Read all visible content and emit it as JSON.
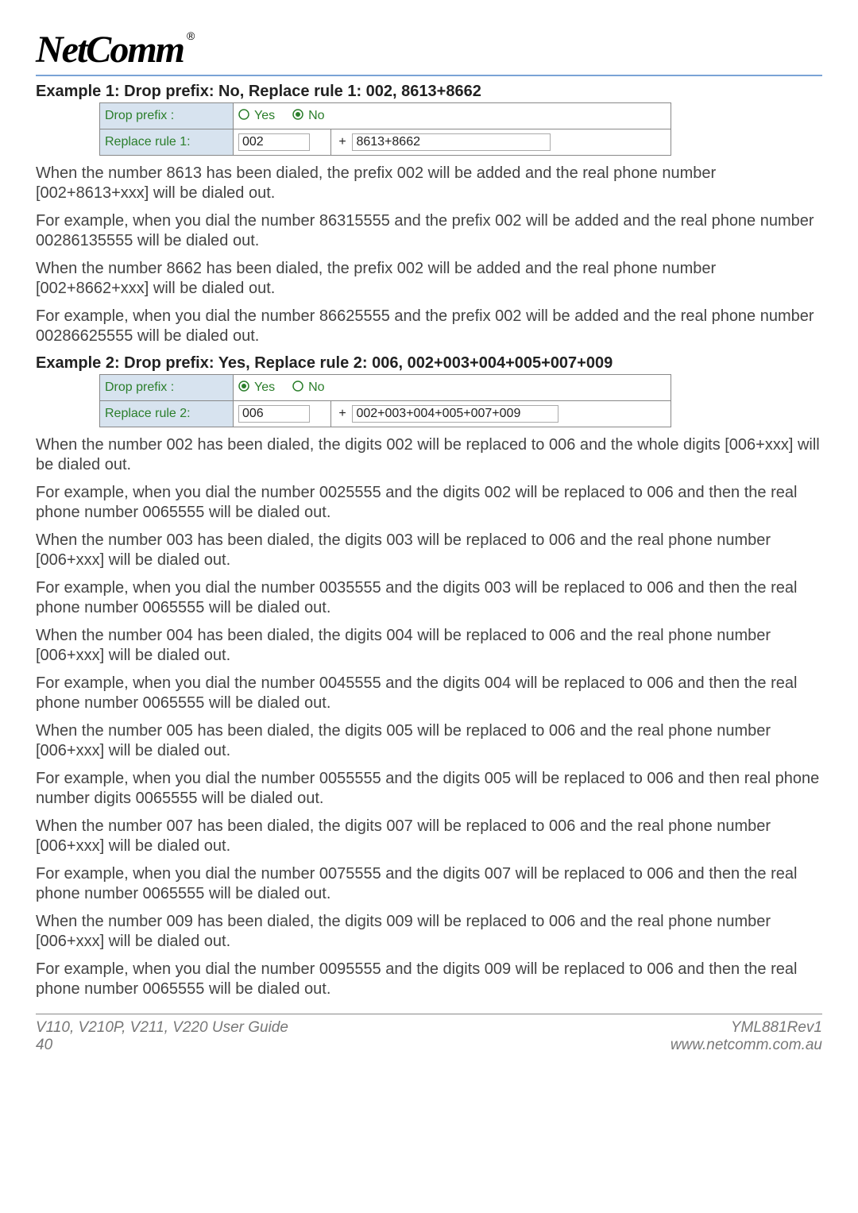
{
  "logo": {
    "text": "NetComm",
    "reg": "®"
  },
  "example1": {
    "heading": "Example 1: Drop prefix: No, Replace rule 1: 002, 8613+8662",
    "dropPrefixLabel": "Drop prefix :",
    "yesLabel": "Yes",
    "noLabel": "No",
    "replaceLabel": "Replace rule 1:",
    "leftValue": "002",
    "rightValue": "8613+8662",
    "p1": "When the number 8613 has been dialed, the prefix 002 will be added and the real phone number [002+8613+xxx] will be dialed out.",
    "p2": "For example, when you dial the number 86315555 and the prefix 002 will be added and the real phone number 00286135555 will be dialed out.",
    "p3": "When the number 8662 has been dialed, the prefix 002 will be added and the real phone number [002+8662+xxx] will be dialed out.",
    "p4": "For example, when you dial the number 86625555 and the prefix 002 will be added and the real phone number 00286625555 will be dialed out."
  },
  "example2": {
    "heading": "Example 2: Drop prefix: Yes, Replace rule 2: 006, 002+003+004+005+007+009",
    "dropPrefixLabel": "Drop prefix :",
    "yesLabel": "Yes",
    "noLabel": "No",
    "replaceLabel": "Replace rule 2:",
    "leftValue": "006",
    "rightValue": "002+003+004+005+007+009",
    "p1": "When the number 002 has been dialed, the digits 002 will be replaced to 006 and the whole digits [006+xxx] will be dialed out.",
    "p2": "For example, when you dial the number 0025555 and the digits 002 will be replaced to 006 and then the real phone number 0065555 will be dialed out.",
    "p3": "When the number 003 has been dialed, the digits 003 will be replaced to 006 and the real phone number [006+xxx] will be dialed out.",
    "p4": "For example, when you dial the number 0035555 and the digits 003 will be replaced to 006 and then the real phone number 0065555 will be dialed out.",
    "p5": "When the number 004 has been dialed, the digits 004 will be replaced to 006 and the real phone number [006+xxx] will be dialed out.",
    "p6": "For example, when you dial the number 0045555 and the digits 004 will be replaced to 006 and then the real phone number 0065555 will be dialed out.",
    "p7": "When the number 005 has been dialed, the digits 005 will be replaced to 006 and the real phone number [006+xxx] will be dialed out.",
    "p8": "For example, when you dial the number 0055555 and the digits 005 will be replaced to 006 and then real phone number digits 0065555 will be dialed out.",
    "p9": "When the number 007 has been dialed, the digits 007 will be replaced to 006 and the real phone number [006+xxx] will be dialed out.",
    "p10": "For example, when you dial the number 0075555 and the digits 007 will be replaced to 006 and then the real phone number 0065555 will be dialed out.",
    "p11": "When the number 009 has been dialed, the digits 009 will be replaced to 006 and the real phone number [006+xxx] will be dialed out.",
    "p12": "For example, when you dial the number 0095555 and the digits 009 will be replaced to 006 and then the real phone number 0065555 will be dialed out."
  },
  "footer": {
    "leftTop": "V110, V210P, V211, V220 User Guide",
    "leftBottom": "40",
    "rightTop": "YML881Rev1",
    "rightBottom": "www.netcomm.com.au"
  },
  "plus": "+"
}
